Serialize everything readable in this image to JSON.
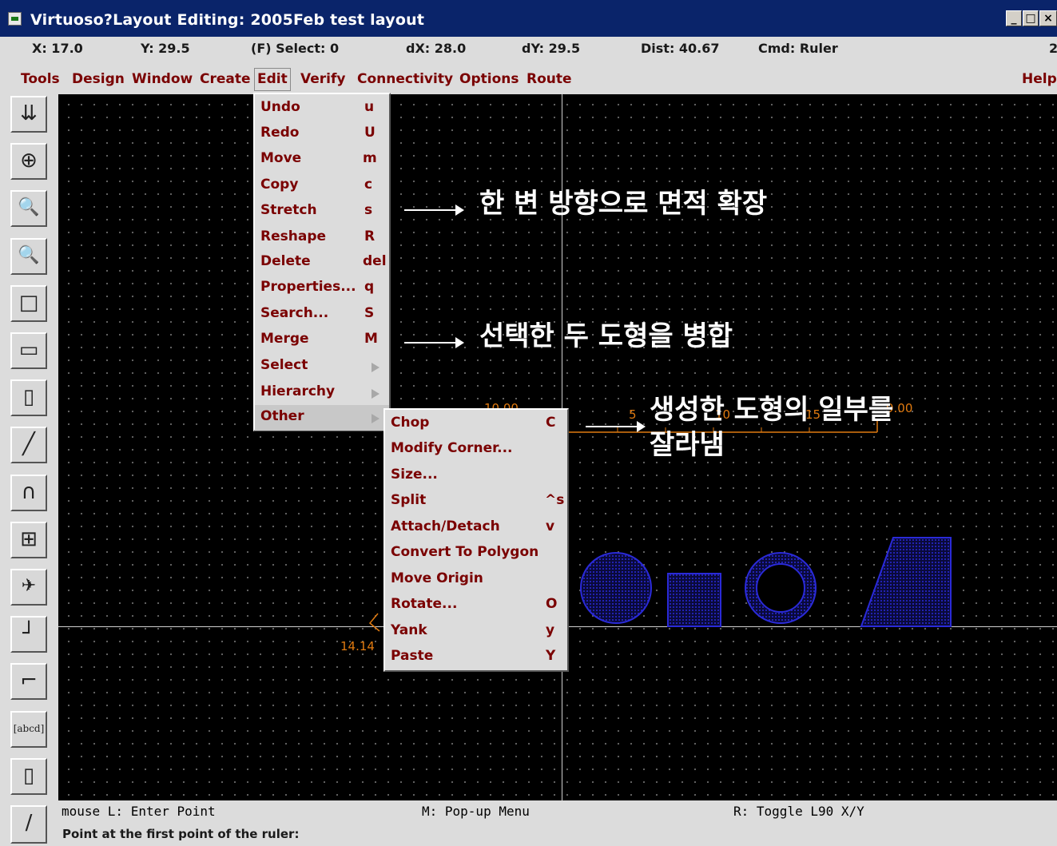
{
  "window": {
    "title": "Virtuoso?Layout Editing: 2005Feb test layout",
    "controls": [
      "_",
      "□",
      "×"
    ]
  },
  "status": {
    "x": "X: 17.0",
    "y": "Y: 29.5",
    "select": "(F) Select: 0",
    "dx": "dX: 28.0",
    "dy": "dY: 29.5",
    "dist": "Dist: 40.67",
    "cmd": "Cmd: Ruler",
    "extra": "2"
  },
  "menubar": {
    "items": [
      "Tools",
      "Design",
      "Window",
      "Create",
      "Edit",
      "Verify",
      "Connectivity",
      "Options",
      "Route"
    ],
    "help": "Help"
  },
  "toolbar": {
    "icons": [
      "save-icon",
      "fit-icon",
      "zoom-in-icon",
      "zoom-out-icon",
      "select-box-icon",
      "window-icon",
      "stretch-box-icon",
      "ruler-pencil-icon",
      "arc-icon",
      "grid-icon",
      "flight-icon",
      "path-icon",
      "polygon-icon",
      "label-icon",
      "rectangle-icon",
      "ruler-icon"
    ],
    "glyphs": [
      "⇊",
      "⊕",
      "🔍",
      "🔍",
      "□",
      "▭",
      "▯",
      "╱",
      "∩",
      "⊞",
      "✈",
      "┘",
      "⌐",
      "[abcd]",
      "▯",
      "/"
    ]
  },
  "edit_menu": {
    "items": [
      {
        "label": "Undo",
        "key": "u"
      },
      {
        "label": "Redo",
        "key": "U"
      },
      {
        "label": "Move",
        "key": "m"
      },
      {
        "label": "Copy",
        "key": "c"
      },
      {
        "label": "Stretch",
        "key": "s"
      },
      {
        "label": "Reshape",
        "key": "R"
      },
      {
        "label": "Delete",
        "key": "del"
      },
      {
        "label": "Properties...",
        "key": "q"
      },
      {
        "label": "Search...",
        "key": "S"
      },
      {
        "label": "Merge",
        "key": "M"
      },
      {
        "label": "Select",
        "key": ""
      },
      {
        "label": "Hierarchy",
        "key": ""
      },
      {
        "label": "Other",
        "key": ""
      }
    ]
  },
  "other_menu": {
    "items": [
      {
        "label": "Chop",
        "key": "C"
      },
      {
        "label": "Modify Corner...",
        "key": ""
      },
      {
        "label": "Size...",
        "key": ""
      },
      {
        "label": "Split",
        "key": "^s"
      },
      {
        "label": "Attach/Detach",
        "key": "v"
      },
      {
        "label": "Convert To Polygon",
        "key": ""
      },
      {
        "label": "Move Origin",
        "key": ""
      },
      {
        "label": "Rotate...",
        "key": "O"
      },
      {
        "label": "Yank",
        "key": "y"
      },
      {
        "label": "Paste",
        "key": "Y"
      }
    ]
  },
  "annotations": {
    "stretch": "한 변 방향으로 면적 확장",
    "merge": "선택한 두 도형을 병합",
    "chop_line1": "생성한 도형의 일부를",
    "chop_line2": "잘라냄"
  },
  "ruler": {
    "top_label": "10.00",
    "mid_label": "5",
    "mid_label2": "10",
    "mid_label3": "15",
    "end_label": "9.00",
    "diag_label": "14.14"
  },
  "colors": {
    "canvas": "#000000",
    "shape": "#2a2ad8",
    "ruler": "#e07a10",
    "menu_text": "#7a0000"
  },
  "prompt": {
    "mouse_l": "mouse L: Enter Point",
    "mouse_m": "M: Pop-up Menu",
    "mouse_r": "R: Toggle L90 X/Y",
    "message": "Point at the first point of the ruler:"
  }
}
